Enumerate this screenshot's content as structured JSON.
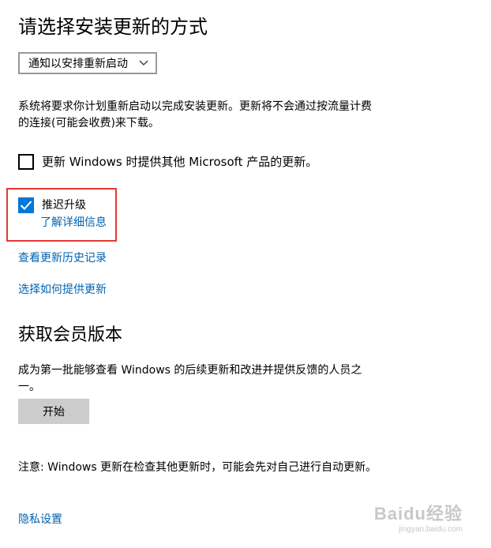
{
  "section1": {
    "title": "请选择安装更新的方式",
    "dropdown": {
      "selected": "通知以安排重新启动",
      "icon": "chevron-down-icon"
    },
    "description": "系统将要求你计划重新启动以完成安装更新。更新将不会通过按流量计费的连接(可能会收费)来下载。",
    "checkbox_other_products": {
      "label": "更新 Windows 时提供其他 Microsoft 产品的更新。",
      "checked": false
    },
    "checkbox_defer": {
      "label": "推迟升级",
      "checked": true,
      "link": "了解详细信息"
    },
    "link_history": "查看更新历史记录",
    "link_delivery": "选择如何提供更新"
  },
  "section2": {
    "title": "获取会员版本",
    "description": "成为第一批能够查看 Windows 的后续更新和改进并提供反馈的人员之一。",
    "start_button": "开始"
  },
  "note": "注意: Windows 更新在检查其他更新时，可能会先对自己进行自动更新。",
  "privacy_link": "隐私设置",
  "watermark": {
    "main": "Baidu经验",
    "sub": "jingyan.baidu.com"
  },
  "colors": {
    "accent": "#0078d7",
    "link": "#0063b1",
    "highlight": "#e53935",
    "button": "#cccccc"
  }
}
